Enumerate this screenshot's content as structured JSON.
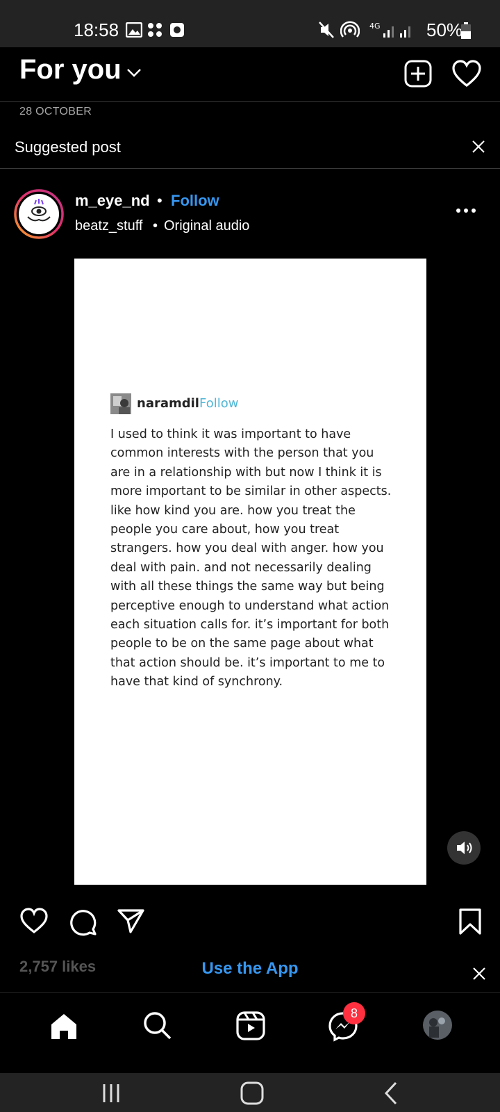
{
  "status_bar": {
    "time": "18:58",
    "battery": "50%"
  },
  "header": {
    "title": "For you"
  },
  "feed": {
    "date": "28 OCTOBER",
    "suggested_label": "Suggested post"
  },
  "post": {
    "username": "m_eye_nd",
    "separator": "•",
    "follow_label": "Follow",
    "audio_author": "beatz_stuff",
    "audio_label": "Original audio",
    "likes": "2,757 likes",
    "image_post": {
      "username": "naramdil",
      "follow_label": "Follow",
      "text": "I used to think it was important to have common interests with the person that you are in a relationship with but now I think it is more important to be similar in other aspects. like how kind you are. how you treat the people you care about, how you treat strangers. how you deal with anger. how you deal with pain. and not necessarily dealing with all these things the same way but being perceptive enough to understand what action each situation calls for. it’s important for both people to be on the same page about what that action should be. it’s important to me to have that kind of synchrony."
    }
  },
  "banner": {
    "use_app_label": "Use the App"
  },
  "nav": {
    "messages_badge": "8"
  },
  "colors": {
    "accent": "#3797f0",
    "badge": "#ff3040",
    "background": "#000000"
  }
}
